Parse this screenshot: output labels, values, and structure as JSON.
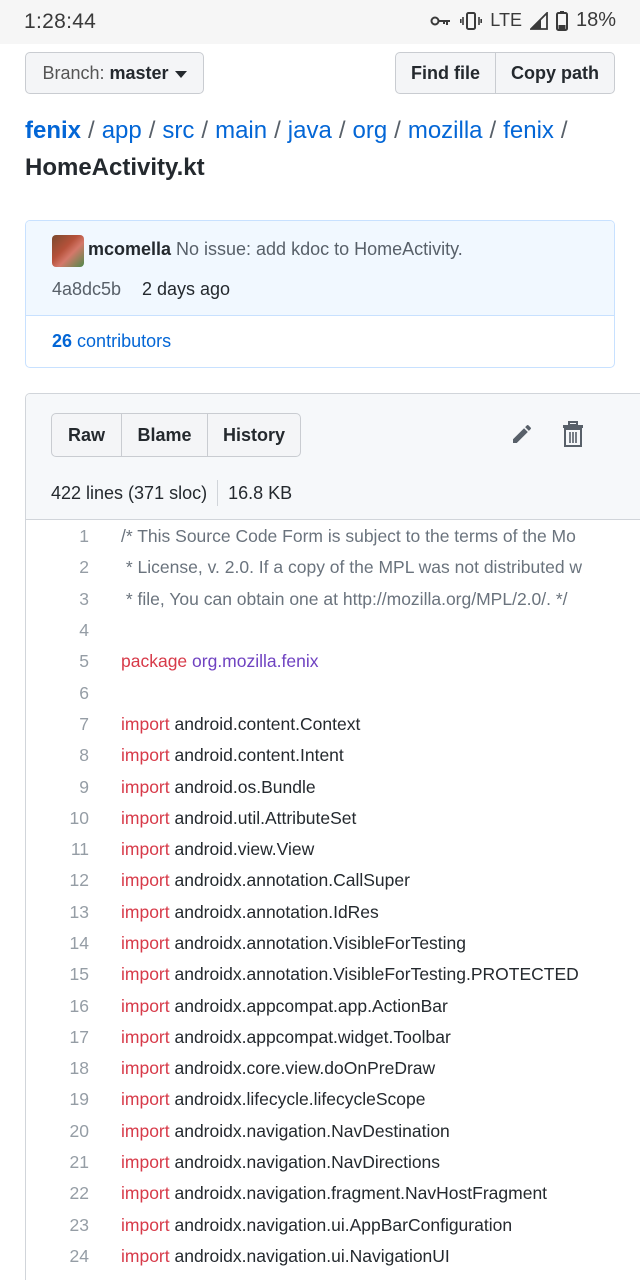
{
  "status_bar": {
    "time": "1:28:44",
    "network": "LTE",
    "battery": "18%"
  },
  "toolbar": {
    "branch_label": "Branch:",
    "branch_value": "master",
    "find_file": "Find file",
    "copy_path": "Copy path"
  },
  "breadcrumb": {
    "segments": [
      "fenix",
      "app",
      "src",
      "main",
      "java",
      "org",
      "mozilla",
      "fenix"
    ],
    "separator": "/",
    "file": "HomeActivity.kt"
  },
  "commit": {
    "author": "mcomella",
    "message": "No issue: add kdoc to HomeActivity.",
    "sha": "4a8dc5b",
    "date": "2 days ago",
    "contributors_count": "26",
    "contributors_label": "contributors"
  },
  "file": {
    "buttons": {
      "raw": "Raw",
      "blame": "Blame",
      "history": "History"
    },
    "lines_info": "422 lines (371 sloc)",
    "size": "16.8 KB"
  },
  "code_lines": [
    {
      "n": "1",
      "parts": [
        {
          "t": "/* This Source Code Form is subject to the terms of the Mo",
          "c": "cm"
        }
      ]
    },
    {
      "n": "2",
      "parts": [
        {
          "t": " * License, v. 2.0. If a copy of the MPL was not distributed w",
          "c": "cm"
        }
      ]
    },
    {
      "n": "3",
      "parts": [
        {
          "t": " * file, You can obtain one at http://mozilla.org/MPL/2.0/. */",
          "c": "cm"
        }
      ]
    },
    {
      "n": "4",
      "parts": []
    },
    {
      "n": "5",
      "parts": [
        {
          "t": "package ",
          "c": "kw"
        },
        {
          "t": "org.mozilla.fenix",
          "c": "pk"
        }
      ]
    },
    {
      "n": "6",
      "parts": []
    },
    {
      "n": "7",
      "parts": [
        {
          "t": "import ",
          "c": "kw"
        },
        {
          "t": "android.content.Context",
          "c": ""
        }
      ]
    },
    {
      "n": "8",
      "parts": [
        {
          "t": "import ",
          "c": "kw"
        },
        {
          "t": "android.content.Intent",
          "c": ""
        }
      ]
    },
    {
      "n": "9",
      "parts": [
        {
          "t": "import ",
          "c": "kw"
        },
        {
          "t": "android.os.Bundle",
          "c": ""
        }
      ]
    },
    {
      "n": "10",
      "parts": [
        {
          "t": "import ",
          "c": "kw"
        },
        {
          "t": "android.util.AttributeSet",
          "c": ""
        }
      ]
    },
    {
      "n": "11",
      "parts": [
        {
          "t": "import ",
          "c": "kw"
        },
        {
          "t": "android.view.View",
          "c": ""
        }
      ]
    },
    {
      "n": "12",
      "parts": [
        {
          "t": "import ",
          "c": "kw"
        },
        {
          "t": "androidx.annotation.CallSuper",
          "c": ""
        }
      ]
    },
    {
      "n": "13",
      "parts": [
        {
          "t": "import ",
          "c": "kw"
        },
        {
          "t": "androidx.annotation.IdRes",
          "c": ""
        }
      ]
    },
    {
      "n": "14",
      "parts": [
        {
          "t": "import ",
          "c": "kw"
        },
        {
          "t": "androidx.annotation.VisibleForTesting",
          "c": ""
        }
      ]
    },
    {
      "n": "15",
      "parts": [
        {
          "t": "import ",
          "c": "kw"
        },
        {
          "t": "androidx.annotation.VisibleForTesting.PROTECTED",
          "c": ""
        }
      ]
    },
    {
      "n": "16",
      "parts": [
        {
          "t": "import ",
          "c": "kw"
        },
        {
          "t": "androidx.appcompat.app.ActionBar",
          "c": ""
        }
      ]
    },
    {
      "n": "17",
      "parts": [
        {
          "t": "import ",
          "c": "kw"
        },
        {
          "t": "androidx.appcompat.widget.Toolbar",
          "c": ""
        }
      ]
    },
    {
      "n": "18",
      "parts": [
        {
          "t": "import ",
          "c": "kw"
        },
        {
          "t": "androidx.core.view.doOnPreDraw",
          "c": ""
        }
      ]
    },
    {
      "n": "19",
      "parts": [
        {
          "t": "import ",
          "c": "kw"
        },
        {
          "t": "androidx.lifecycle.lifecycleScope",
          "c": ""
        }
      ]
    },
    {
      "n": "20",
      "parts": [
        {
          "t": "import ",
          "c": "kw"
        },
        {
          "t": "androidx.navigation.NavDestination",
          "c": ""
        }
      ]
    },
    {
      "n": "21",
      "parts": [
        {
          "t": "import ",
          "c": "kw"
        },
        {
          "t": "androidx.navigation.NavDirections",
          "c": ""
        }
      ]
    },
    {
      "n": "22",
      "parts": [
        {
          "t": "import ",
          "c": "kw"
        },
        {
          "t": "androidx.navigation.fragment.NavHostFragment",
          "c": ""
        }
      ]
    },
    {
      "n": "23",
      "parts": [
        {
          "t": "import ",
          "c": "kw"
        },
        {
          "t": "androidx.navigation.ui.AppBarConfiguration",
          "c": ""
        }
      ]
    },
    {
      "n": "24",
      "parts": [
        {
          "t": "import ",
          "c": "kw"
        },
        {
          "t": "androidx.navigation.ui.NavigationUI",
          "c": ""
        }
      ]
    }
  ]
}
